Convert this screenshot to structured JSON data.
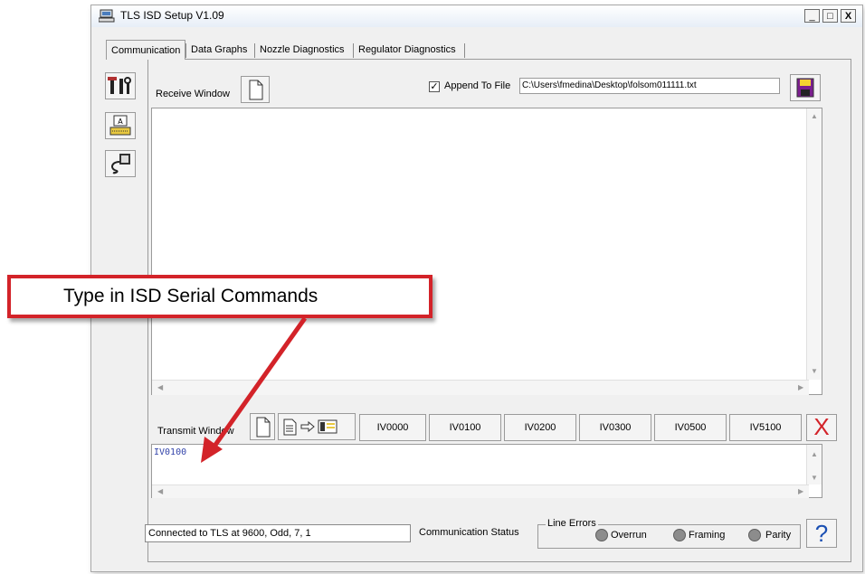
{
  "window": {
    "title": "TLS ISD Setup V1.09",
    "min": "_",
    "max": "□",
    "close": "X"
  },
  "tabs": [
    "Communication",
    "Data Graphs",
    "Nozzle Diagnostics",
    "Regulator Diagnostics"
  ],
  "receive": {
    "label": "Receive Window",
    "append_checked": "✓",
    "append_label": "Append To File",
    "file_path": "C:\\Users\\fmedina\\Desktop\\folsom011111.txt"
  },
  "transmit": {
    "label": "Transmit Window",
    "commands": [
      "IV0000",
      "IV0100",
      "IV0200",
      "IV0300",
      "IV0500",
      "IV5100"
    ],
    "clear": "X",
    "text": "IV0100"
  },
  "status": {
    "connection": "Connected to TLS at 9600, Odd, 7, 1",
    "comm_label": "Communication Status",
    "line_errors_label": "Line Errors",
    "errors": [
      "Overrun",
      "Framing",
      "Parity"
    ],
    "help": "?"
  },
  "callout": {
    "text": "Type in ISD Serial Commands"
  },
  "colors": {
    "accent_red": "#d32329",
    "transmit_text": "#3344aa"
  },
  "icons": [
    "computer-icon",
    "tools-icon",
    "keyboard-icon",
    "serial-cable-icon",
    "new-file-icon",
    "save-disk-icon",
    "file-to-table-icon",
    "help-icon"
  ]
}
